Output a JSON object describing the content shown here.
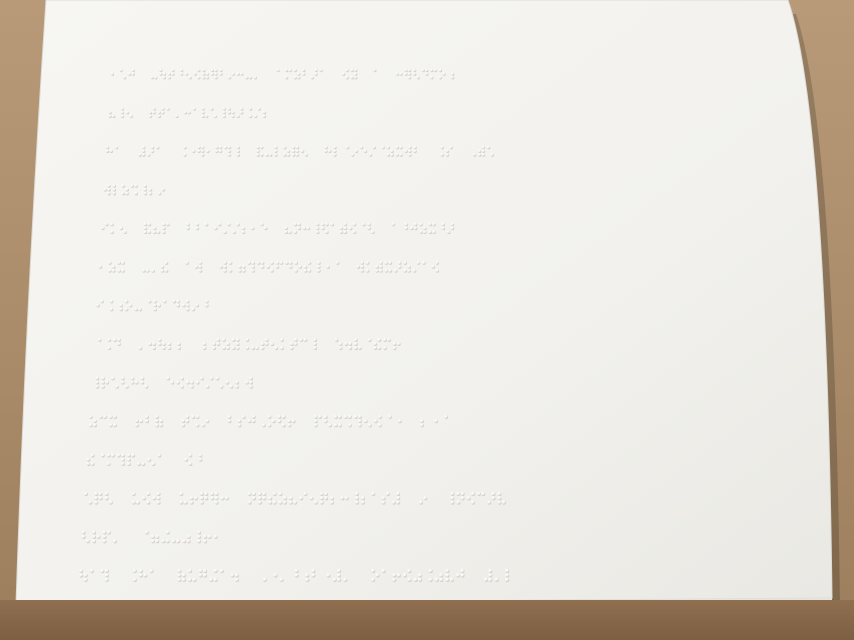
{
  "scene": {
    "subject": "braille-embossed-sheet",
    "colors": {
      "table": "#a88a68",
      "paper": "#f4f3ef",
      "paper_edge": "#e2e1dc",
      "dot_light": "#ffffff",
      "dot_shadow": "#c9c8c3"
    }
  },
  "braille_rows": [
    {
      "words": [
        3,
        13,
        6,
        2,
        1,
        7
      ]
    },
    {
      "words": [
        3,
        14
      ]
    },
    {
      "words": [
        2,
        3,
        7,
        6,
        11,
        2,
        3
      ]
    },
    {
      "words": [
        7
      ]
    },
    {
      "words": [
        3,
        3,
        9,
        10,
        7
      ]
    },
    {
      "words": [
        3,
        3,
        2,
        13,
        9
      ]
    },
    {
      "words": [
        12
      ]
    },
    {
      "words": [
        3,
        5,
        12,
        7
      ]
    },
    {
      "words": [
        6,
        9
      ]
    },
    {
      "words": [
        3,
        3,
        3,
        7,
        9,
        3
      ]
    },
    {
      "words": [
        8,
        2
      ]
    },
    {
      "words": [
        3,
        3,
        5,
        15,
        1,
        6
      ]
    },
    {
      "words": [
        4,
        8
      ]
    },
    {
      "words": [
        3,
        3,
        6,
        9,
        9,
        3
      ]
    },
    {
      "words": [
        11,
        3,
        6
      ]
    }
  ]
}
